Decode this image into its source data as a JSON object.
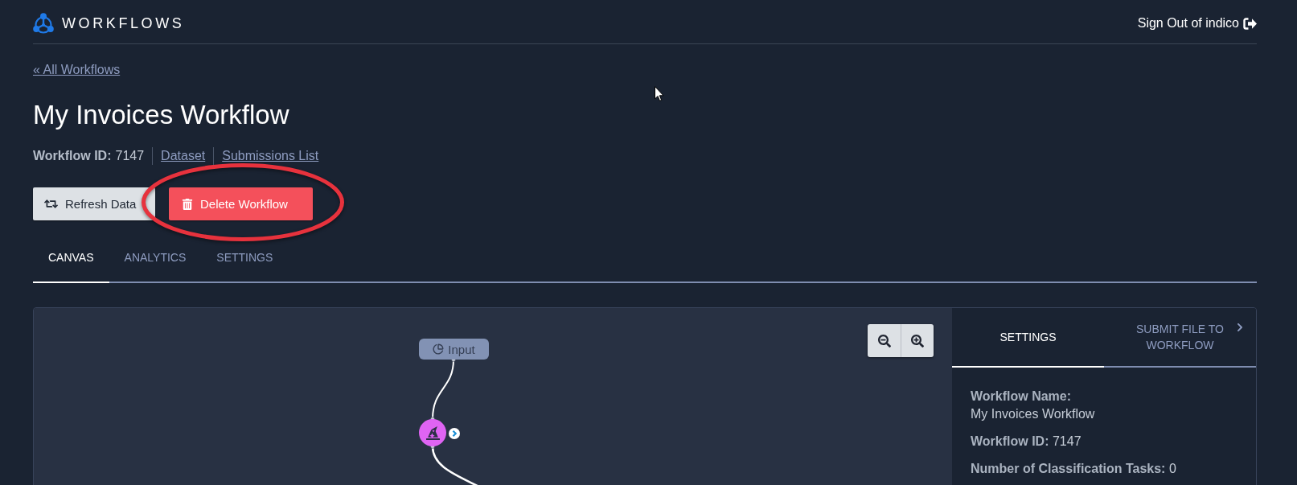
{
  "header": {
    "brand": "WORKFLOWS",
    "sign_out": "Sign Out of indico"
  },
  "back_link": "« All Workflows",
  "title": "My Invoices Workflow",
  "meta": [
    {
      "kind": "pair",
      "label": "Workflow ID:",
      "value": "7147"
    },
    {
      "kind": "link",
      "text": "Dataset"
    },
    {
      "kind": "link",
      "text": "Submissions List"
    }
  ],
  "actions": [
    {
      "kind": "secondary",
      "label": "Refresh Data",
      "circled": false
    },
    {
      "kind": "danger",
      "label": "Delete Workflow",
      "circled": true
    }
  ],
  "tabs": [
    {
      "label": "CANVAS",
      "selected": true
    },
    {
      "label": "ANALYTICS",
      "selected": false
    },
    {
      "label": "SETTINGS",
      "selected": false
    }
  ],
  "canvas": {
    "nodes": [
      {
        "kind": "input",
        "label": "Input"
      },
      {
        "kind": "model"
      }
    ]
  },
  "side_panel": {
    "tabs": [
      {
        "kind": "plain",
        "label": "SETTINGS",
        "selected": true
      },
      {
        "kind": "next",
        "label": "SUBMIT FILE TO WORKFLOW",
        "selected": false
      }
    ],
    "fields": [
      {
        "kind": "block",
        "label": "Workflow Name:",
        "value": "My Invoices Workflow"
      },
      {
        "kind": "inline",
        "label": "Workflow ID:",
        "value": "7147"
      },
      {
        "kind": "inline",
        "label": "Number of Classification Tasks:",
        "value": "0"
      }
    ]
  }
}
